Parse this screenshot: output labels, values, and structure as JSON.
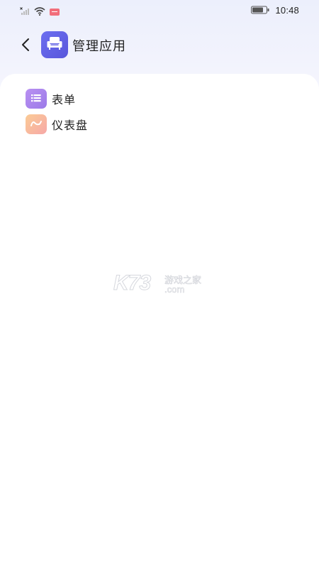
{
  "status_bar": {
    "time": "10:48",
    "icons": [
      "no-signal-icon",
      "wifi-icon",
      "sim-alert-icon",
      "battery-icon"
    ]
  },
  "header": {
    "back_icon": "chevron-left-icon",
    "app_icon": "couch-icon",
    "title": "管理应用"
  },
  "menu": {
    "items": [
      {
        "label": "表单",
        "icon": "list-icon",
        "color": "#a384ee"
      },
      {
        "label": "仪表盘",
        "icon": "trend-line-icon",
        "color": "#f8b99d"
      }
    ]
  },
  "watermark": {
    "logo": "K73",
    "text_cn": "游戏之家",
    "domain": ".com"
  },
  "colors": {
    "accent": "#5f60e3",
    "background_top": "#eceffc",
    "card": "#ffffff"
  }
}
